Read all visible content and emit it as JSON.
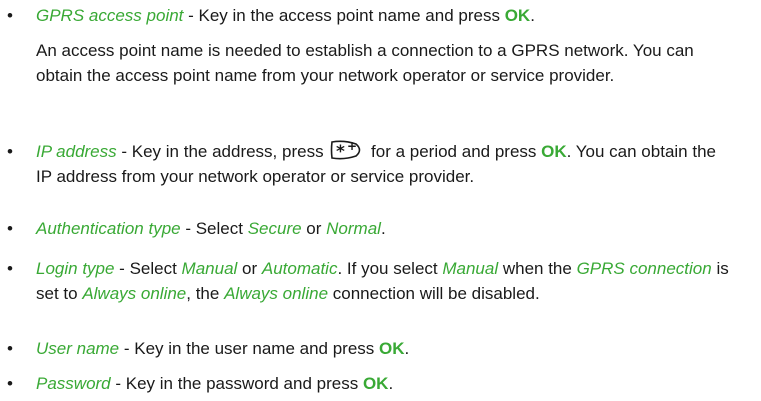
{
  "items": [
    {
      "term": "GPRS access point",
      "sep": " - ",
      "text1": "Key in the access point name and press ",
      "ok": "OK",
      "end": "."
    },
    {
      "para": "An access point name is needed to establish a connection to a GPRS network. You can obtain the access point name from your network operator or service provider."
    },
    {
      "term": "IP address",
      "sep": " - ",
      "text1": "Key in the address, press ",
      "icon": "star-key-icon",
      "text2": " for a period and press ",
      "ok": "OK",
      "text3": ". You can obtain the IP address from your network operator or service provider."
    },
    {
      "term": "Authentication type",
      "sep": " - ",
      "text1": "Select ",
      "opt1": "Secure",
      "or": " or ",
      "opt2": "Normal",
      "end": "."
    },
    {
      "term": "Login type",
      "sep": " - ",
      "text1": "Select ",
      "opt1": "Manual",
      "or": " or ",
      "opt2": "Automatic",
      "t2": ". If you select ",
      "opt3": "Manual",
      "t3": " when the ",
      "opt4": "GPRS connection",
      "t4": " is set to ",
      "opt5": "Always online",
      "t5": ", the ",
      "opt6": "Always online",
      "t6": " connection will be disabled."
    },
    {
      "term": "User name",
      "sep": " - ",
      "text1": "Key in the user name and press ",
      "ok": "OK",
      "end": "."
    },
    {
      "term": "Password",
      "sep": " - ",
      "text1": "Key in the password and press ",
      "ok": "OK",
      "end": "."
    }
  ],
  "bullet": "•",
  "colors": {
    "accent": "#39a935",
    "text": "#1a1a1a"
  }
}
